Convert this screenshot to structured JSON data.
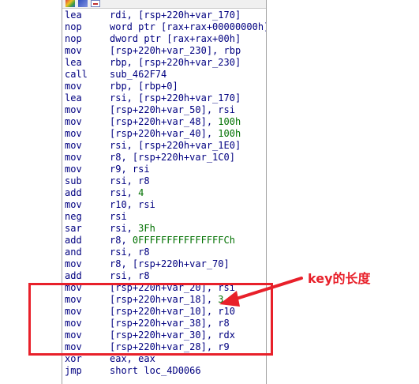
{
  "toolbar": {
    "icons": [
      "graph-view-icon",
      "edit-view-icon",
      "hex-view-icon"
    ]
  },
  "lines": [
    {
      "mnemonic": "lea",
      "operand": "rdi, [rsp+220h+var_170]"
    },
    {
      "mnemonic": "nop",
      "operand": "word ptr [rax+rax+00000000h]"
    },
    {
      "mnemonic": "nop",
      "operand": "dword ptr [rax+rax+00h]"
    },
    {
      "mnemonic": "mov",
      "operand": "[rsp+220h+var_230], rbp"
    },
    {
      "mnemonic": "lea",
      "operand": "rbp, [rsp+220h+var_230]"
    },
    {
      "mnemonic": "call",
      "operand": "sub_462F74"
    },
    {
      "mnemonic": "mov",
      "operand": "rbp, [rbp+0]"
    },
    {
      "mnemonic": "lea",
      "operand": "rsi, [rsp+220h+var_170]"
    },
    {
      "mnemonic": "mov",
      "operand": "[rsp+220h+var_50], rsi"
    },
    {
      "mnemonic": "mov",
      "operand": "[rsp+220h+var_48], 100h"
    },
    {
      "mnemonic": "mov",
      "operand": "[rsp+220h+var_40], 100h"
    },
    {
      "mnemonic": "mov",
      "operand": "rsi, [rsp+220h+var_1E0]"
    },
    {
      "mnemonic": "mov",
      "operand": "r8, [rsp+220h+var_1C0]"
    },
    {
      "mnemonic": "mov",
      "operand": "r9, rsi"
    },
    {
      "mnemonic": "sub",
      "operand": "rsi, r8"
    },
    {
      "mnemonic": "add",
      "operand": "rsi, 4"
    },
    {
      "mnemonic": "mov",
      "operand": "r10, rsi"
    },
    {
      "mnemonic": "neg",
      "operand": "rsi"
    },
    {
      "mnemonic": "sar",
      "operand": "rsi, 3Fh"
    },
    {
      "mnemonic": "add",
      "operand": "r8, 0FFFFFFFFFFFFFFFCh"
    },
    {
      "mnemonic": "and",
      "operand": "rsi, r8"
    },
    {
      "mnemonic": "mov",
      "operand": "r8, [rsp+220h+var_70]"
    },
    {
      "mnemonic": "add",
      "operand": "rsi, r8"
    },
    {
      "mnemonic": "mov",
      "operand": "[rsp+220h+var_20], rsi"
    },
    {
      "mnemonic": "mov",
      "operand": "[rsp+220h+var_18], 3"
    },
    {
      "mnemonic": "mov",
      "operand": "[rsp+220h+var_10], r10"
    },
    {
      "mnemonic": "mov",
      "operand": "[rsp+220h+var_38], r8"
    },
    {
      "mnemonic": "mov",
      "operand": "[rsp+220h+var_30], rdx"
    },
    {
      "mnemonic": "mov",
      "operand": "[rsp+220h+var_28], r9"
    },
    {
      "mnemonic": "xor",
      "operand": "eax, eax"
    },
    {
      "mnemonic": "jmp",
      "operand": "short loc_4D0066"
    }
  ],
  "annotation": {
    "label": "key的长度",
    "color": "#e8202a"
  },
  "colors": {
    "code_text": "#000080",
    "immediate": "#007000"
  }
}
